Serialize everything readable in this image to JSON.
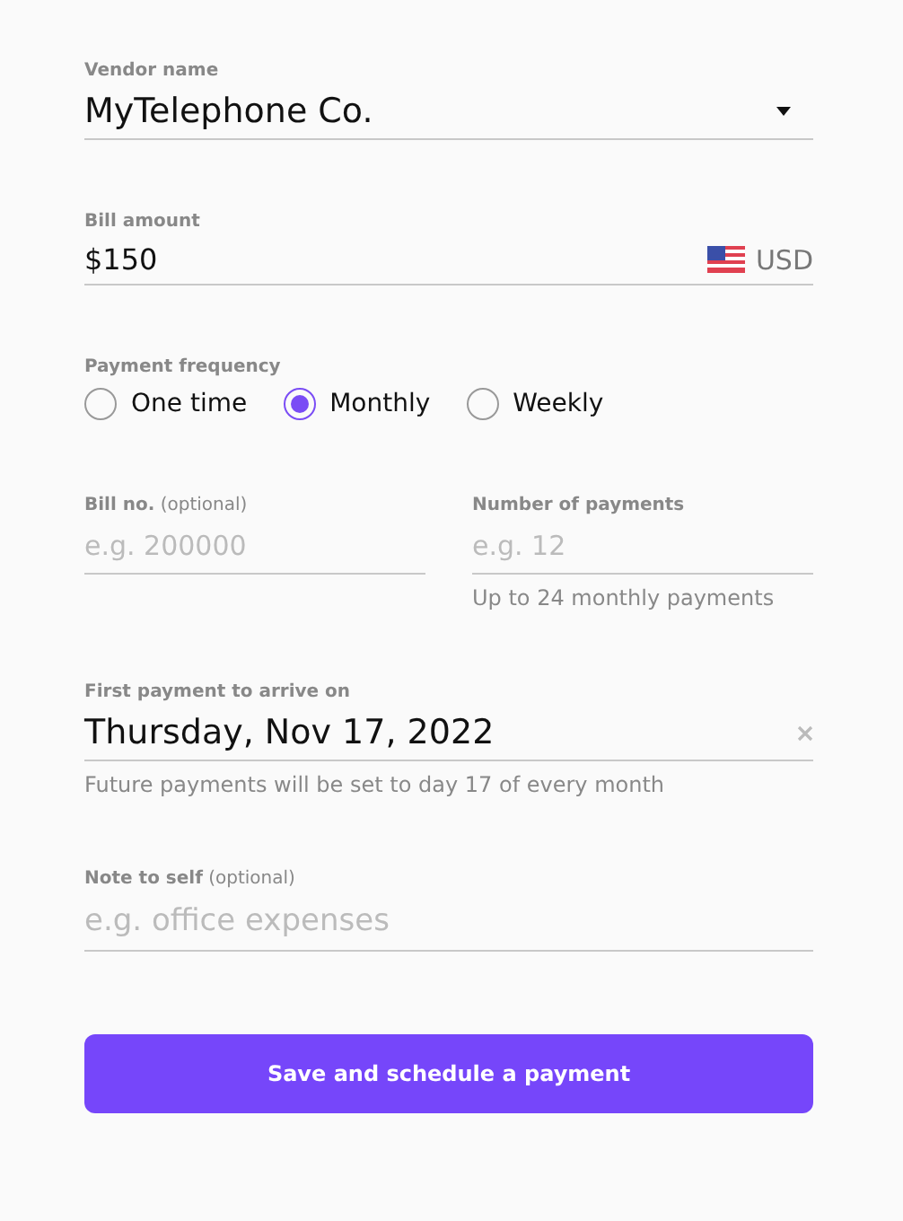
{
  "vendor": {
    "label": "Vendor name",
    "value": "MyTelephone Co."
  },
  "amount": {
    "label": "Bill amount",
    "value": "$150",
    "currency": "USD"
  },
  "frequency": {
    "label": "Payment frequency",
    "options": [
      {
        "label": "One time",
        "selected": false
      },
      {
        "label": "Monthly",
        "selected": true
      },
      {
        "label": "Weekly",
        "selected": false
      }
    ]
  },
  "bill_no": {
    "label": "**Bill no.** (optional)",
    "placeholder": "e.g. 200000"
  },
  "num_payments": {
    "label": "Number of payments",
    "placeholder": "e.g. 12",
    "helper": "Up to 24 monthly payments"
  },
  "first_payment": {
    "label": "First payment to arrive on",
    "value": "Thursday, Nov 17, 2022",
    "helper": "Future payments will be set to day 17 of every month"
  },
  "note": {
    "label": "**Note to self** (optional)",
    "placeholder": "e.g. office expenses"
  },
  "submit": "Save and schedule a payment"
}
